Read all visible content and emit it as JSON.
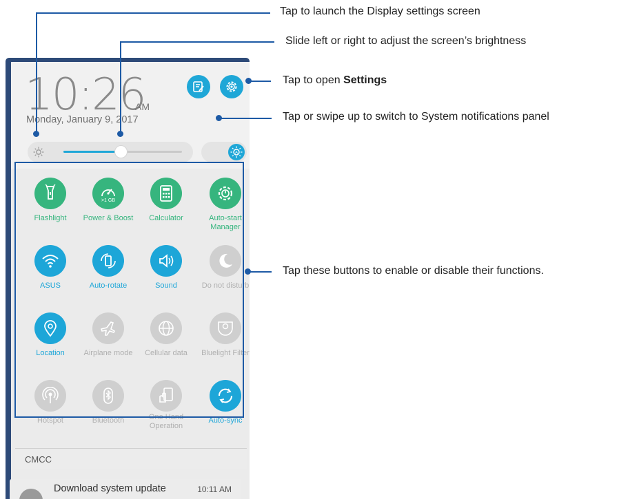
{
  "clock": {
    "time": "10:26",
    "ampm": "AM",
    "date": "Monday, January 9, 2017"
  },
  "brightness": {
    "level": 0.48
  },
  "tiles": [
    {
      "label": "Flashlight",
      "state": "on-green",
      "icon": "flashlight-icon"
    },
    {
      "label": "Power & Boost",
      "state": "on-green",
      "icon": "boost-gauge-icon",
      "badge": ">1 GB"
    },
    {
      "label": "Calculator",
      "state": "on-green",
      "icon": "calculator-icon"
    },
    {
      "label": "Auto-start Manager",
      "state": "on-green",
      "icon": "gear-power-icon"
    },
    {
      "label": "ASUS",
      "state": "on-blue",
      "icon": "wifi-icon"
    },
    {
      "label": "Auto-rotate",
      "state": "on-blue",
      "icon": "auto-rotate-icon"
    },
    {
      "label": "Sound",
      "state": "on-blue",
      "icon": "speaker-icon"
    },
    {
      "label": "Do not disturb",
      "state": "off",
      "icon": "moon-icon"
    },
    {
      "label": "Location",
      "state": "on-blue",
      "icon": "location-pin-icon"
    },
    {
      "label": "Airplane mode",
      "state": "off",
      "icon": "airplane-icon"
    },
    {
      "label": "Cellular data",
      "state": "off",
      "icon": "globe-icon"
    },
    {
      "label": "Bluelight Filter",
      "state": "off",
      "icon": "bluelight-filter-icon"
    },
    {
      "label": "Hotspot",
      "state": "off",
      "icon": "hotspot-icon"
    },
    {
      "label": "Bluetooth",
      "state": "off",
      "icon": "bluetooth-icon"
    },
    {
      "label": "One Hand Operation",
      "state": "off",
      "icon": "one-hand-icon"
    },
    {
      "label": "Auto-sync",
      "state": "on-blue",
      "icon": "sync-icon"
    }
  ],
  "carrier": "CMCC",
  "notification": {
    "title": "Download system update",
    "time": "10:11 AM"
  },
  "callouts": {
    "display": "Tap to launch the Display settings screen",
    "brightness": "Slide left or right to adjust the screen’s brightness",
    "settings_prefix": "Tap to open ",
    "settings_bold": "Settings",
    "system": "Tap or swipe up to switch to System notifications panel",
    "buttons": "Tap these buttons to enable or disable their functions."
  },
  "colors": {
    "green": "#36b57e",
    "blue": "#1da6d8",
    "off": "#cfcfcf",
    "callout_line": "#1d5aa5"
  }
}
